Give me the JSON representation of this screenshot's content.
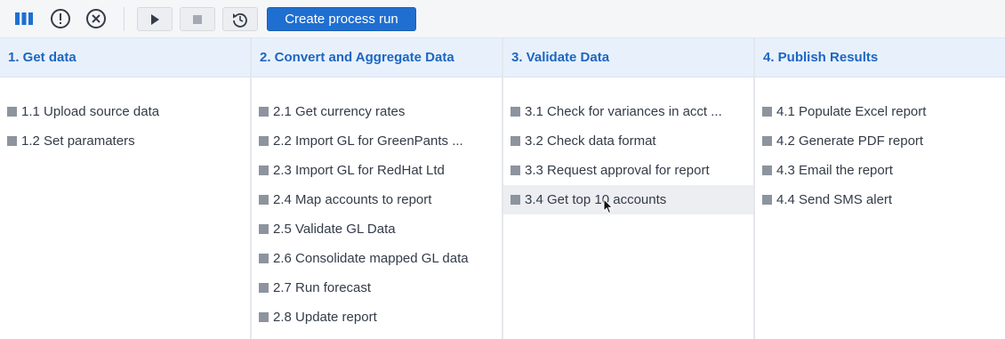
{
  "toolbar": {
    "icons": [
      "columns-icon",
      "alert-icon",
      "cancel-icon"
    ],
    "controls": [
      "play-icon",
      "stop-icon",
      "reset-icon"
    ],
    "create_label": "Create process run",
    "accent": "#1f6fd1"
  },
  "columns": [
    {
      "title": "1. Get data",
      "tasks": [
        "1.1 Upload source data",
        "1.2 Set paramaters"
      ]
    },
    {
      "title": "2. Convert and Aggregate Data",
      "tasks": [
        "2.1 Get currency rates",
        "2.2 Import GL for GreenPants ...",
        "2.3 Import GL for RedHat Ltd",
        "2.4 Map accounts to report",
        "2.5 Validate GL Data",
        "2.6 Consolidate mapped GL data",
        "2.7 Run forecast",
        "2.8 Update report"
      ]
    },
    {
      "title": "3. Validate Data",
      "tasks": [
        "3.1 Check for variances in acct ...",
        "3.2 Check data format",
        "3.3 Request approval for report",
        "3.4 Get top 10 accounts"
      ]
    },
    {
      "title": "4. Publish Results",
      "tasks": [
        "4.1 Populate Excel report",
        "4.2 Generate PDF report",
        "4.3 Email the report",
        "4.4 Send SMS alert"
      ]
    }
  ]
}
